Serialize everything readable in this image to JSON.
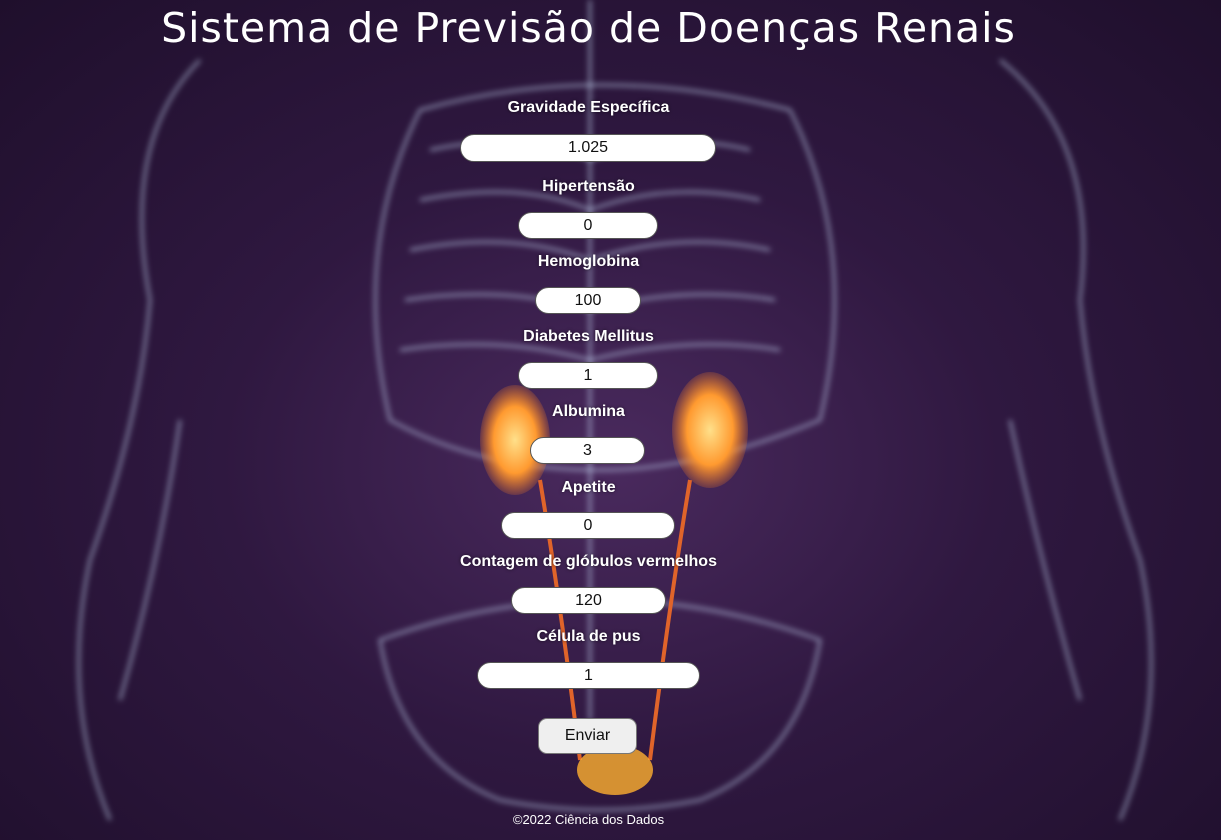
{
  "header": {
    "title": "Sistema de Previsão de Doenças Renais"
  },
  "form": {
    "fields": [
      {
        "label": "Gravidade Específica",
        "value": "1.025"
      },
      {
        "label": "Hipertensão",
        "value": "0"
      },
      {
        "label": "Hemoglobina",
        "value": "100"
      },
      {
        "label": "Diabetes Mellitus",
        "value": "1"
      },
      {
        "label": "Albumina",
        "value": "3"
      },
      {
        "label": "Apetite",
        "value": "0"
      },
      {
        "label": "Contagem de glóbulos vermelhos",
        "value": "120"
      },
      {
        "label": "Célula de pus",
        "value": "1"
      }
    ],
    "submit_label": "Enviar"
  },
  "footer": {
    "text": "©2022 Ciência dos Dados"
  },
  "colors": {
    "background": "#2f1840",
    "skeleton": "#cfe6ff",
    "kidney": "#ff9a30"
  }
}
